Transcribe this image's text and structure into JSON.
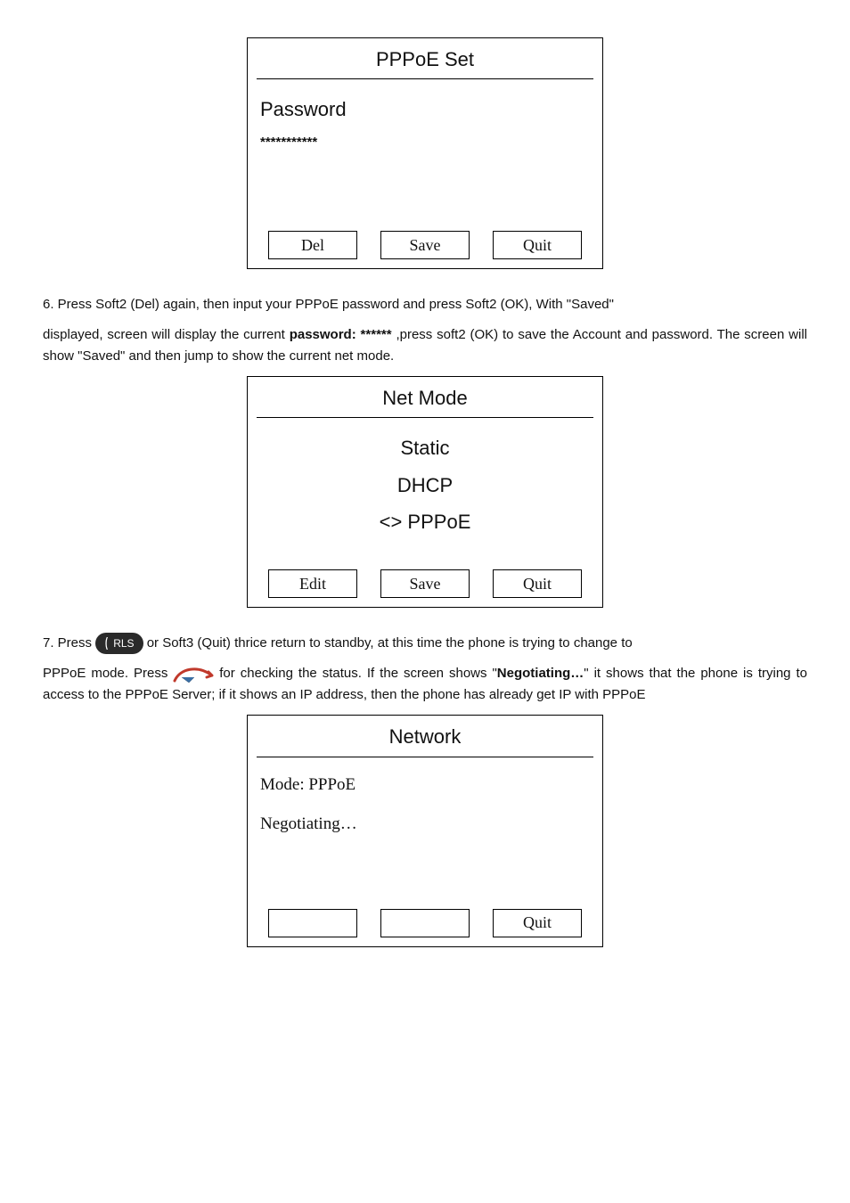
{
  "screen1": {
    "title": "PPPoE Set",
    "label": "Password",
    "value": "***********",
    "soft1": "Del",
    "soft2": "Save",
    "soft3": "Quit"
  },
  "para1_a": "6. Press Soft2 (Del) again, then input your PPPoE password and press Soft2 (OK), With \"Saved\"",
  "para1_b_pre": "displayed, screen will display the current ",
  "para1_b_bold": "password: ******",
  "para1_b_post": ",press soft2 (OK) to save the Account and password. The screen will show \"Saved\" and then jump to show the current net mode.",
  "screen2": {
    "title": "Net Mode",
    "opt1": "Static",
    "opt2": "DHCP",
    "opt3": "<> PPPoE",
    "soft1": "Edit",
    "soft2": "Save",
    "soft3": "Quit"
  },
  "para2_a_pre": "7. Press ",
  "rls_label": "RLS",
  "para2_a_post": "or Soft3 (Quit) thrice return to standby, at this time the phone is trying to change to",
  "para2_b_pre": "PPPoE mode. Press ",
  "para2_b_mid": "for checking the status. If the screen shows \"",
  "para2_b_bold": "Negotiating…",
  "para2_b_post": "\" it shows that the phone is trying to access to the PPPoE Server; if it shows an IP address, then the phone has already get IP with PPPoE",
  "screen3": {
    "title": "Network",
    "line1": "Mode: PPPoE",
    "line2": "Negotiating…",
    "soft3": "Quit"
  }
}
